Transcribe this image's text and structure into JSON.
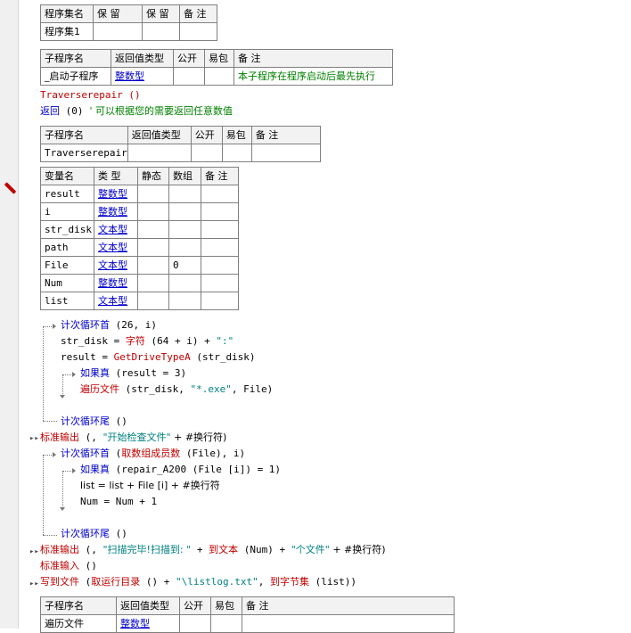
{
  "program_set_table": {
    "headers": [
      "程序集名",
      "保 留",
      "保 留",
      "备 注"
    ],
    "row": [
      "程序集1",
      "",
      "",
      ""
    ]
  },
  "startup_sub_table": {
    "headers": [
      "子程序名",
      "返回值类型",
      "公开",
      "易包",
      "备 注"
    ],
    "row": [
      "_启动子程序",
      "整数型",
      "",
      "",
      "本子程序在程序启动后最先执行"
    ]
  },
  "code1": {
    "call_traverse": "Traverserepair ()",
    "return_kw": "返回",
    "return_args": " (0)",
    "return_comment": "  ' 可以根据您的需要返回任意数值"
  },
  "traverse_sub_table": {
    "headers": [
      "子程序名",
      "返回值类型",
      "公开",
      "易包",
      "备 注"
    ],
    "row": [
      "Traverserepair",
      "",
      "",
      "",
      ""
    ]
  },
  "var_table": {
    "headers": [
      "变量名",
      "类 型",
      "静态",
      "数组",
      "备 注"
    ],
    "rows": [
      {
        "name": "result",
        "type": "整数型",
        "static": "",
        "array": "",
        "note": ""
      },
      {
        "name": "i",
        "type": "整数型",
        "static": "",
        "array": "",
        "note": ""
      },
      {
        "name": "str_disk",
        "type": "文本型",
        "static": "",
        "array": "",
        "note": ""
      },
      {
        "name": "path",
        "type": "文本型",
        "static": "",
        "array": "",
        "note": ""
      },
      {
        "name": "File",
        "type": "文本型",
        "static": "",
        "array": "0",
        "note": ""
      },
      {
        "name": "Num",
        "type": "整数型",
        "static": "",
        "array": "",
        "note": ""
      },
      {
        "name": "list",
        "type": "文本型",
        "static": "",
        "array": "",
        "note": ""
      }
    ]
  },
  "code2": {
    "l1_kw": "计次循环首",
    "l1_args": " (26, i)",
    "l2_a": "str_disk = ",
    "l2_fn": "字符",
    "l2_b": " (64 + i) + ",
    "l2_str": "\":\"",
    "l3_a": "result = ",
    "l3_fn": "GetDriveTypeA",
    "l3_b": " (str_disk)",
    "l4_kw": "如果真",
    "l4_args": " (result = 3)",
    "l5_fn": "遍历文件",
    "l5_a": " (str_disk, ",
    "l5_str": "\"*.exe\"",
    "l5_b": ", File)",
    "l6_kw": "计次循环尾",
    "l6_args": " ()",
    "l7_fn": "标准输出",
    "l7_a": " (, ",
    "l7_str": "\"开始检查文件\"",
    "l7_b": " + #换行符)",
    "l8_kw": "计次循环首",
    "l8_a": " (",
    "l8_fn": "取数组成员数",
    "l8_b": " (File), i)",
    "l9_kw": "如果真",
    "l9_args": " (repair_A200 (File [i]) = 1)",
    "l10": "list = list + File [i] + #换行符",
    "l11": "Num = Num + 1",
    "l12_kw": "计次循环尾",
    "l12_args": " ()",
    "l13_fn": "标准输出",
    "l13_a": " (, ",
    "l13_str": "\"扫描完毕!扫描到: \"",
    "l13_b": " + ",
    "l13_fn2": "到文本",
    "l13_c": " (Num) + ",
    "l13_str2": "\"个文件\"",
    "l13_d": " + #换行符)",
    "l14_fn": "标准输入",
    "l14_args": " ()",
    "l15_fn": "写到文件",
    "l15_a": " (",
    "l15_fn2": "取运行目录",
    "l15_b": " () + ",
    "l15_str": "\"\\listlog.txt\"",
    "l15_c": ", ",
    "l15_fn3": "到字节集",
    "l15_d": " (list))"
  },
  "last_sub_table": {
    "headers": [
      "子程序名",
      "返回值类型",
      "公开",
      "易包",
      "备 注"
    ],
    "row": [
      "遍历文件",
      "整数型",
      "",
      "",
      ""
    ]
  },
  "colors": {
    "keyword": "#0000cc",
    "function": "#c00000",
    "string": "#008080",
    "comment": "#008000",
    "guide": "#777777"
  }
}
